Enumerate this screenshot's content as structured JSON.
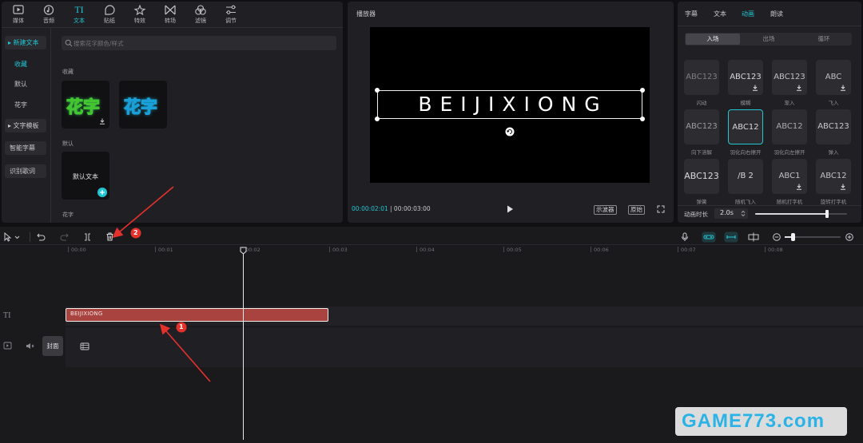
{
  "toolbar": {
    "tabs": [
      {
        "label": "媒体",
        "icon": "media-icon"
      },
      {
        "label": "音频",
        "icon": "audio-icon"
      },
      {
        "label": "文本",
        "icon": "text-icon",
        "active": true
      },
      {
        "label": "贴纸",
        "icon": "sticker-icon"
      },
      {
        "label": "特效",
        "icon": "effects-icon"
      },
      {
        "label": "转场",
        "icon": "transition-icon"
      },
      {
        "label": "滤镜",
        "icon": "filter-icon"
      },
      {
        "label": "调节",
        "icon": "adjust-icon"
      }
    ]
  },
  "sidebar": {
    "items": [
      {
        "label": "▸ 新建文本"
      },
      {
        "label": "收藏"
      },
      {
        "label": "默认"
      },
      {
        "label": "花字"
      },
      {
        "label": "▸ 文字模板"
      },
      {
        "label": "智能字幕"
      },
      {
        "label": "识别歌词"
      }
    ]
  },
  "library": {
    "search_placeholder": "搜索花字颜色/样式",
    "section_favorites": "收藏",
    "thumb1_text": "花字",
    "thumb2_text": "花字",
    "section_default": "默认",
    "default_text": "默认文本",
    "section_huazi": "花字"
  },
  "player": {
    "title": "播放器",
    "preview_text": "BEIJIXIONG",
    "current_time": "00:00:02:01",
    "total_time": "00:00:03:00",
    "btn_waveform": "示波器",
    "btn_original": "原始"
  },
  "inspector": {
    "tabs": [
      "字幕",
      "文本",
      "动画",
      "朗读"
    ],
    "active_tab": "动画",
    "subtabs": [
      "入场",
      "出场",
      "循环"
    ],
    "cells": [
      {
        "text": "ABC123",
        "label": "闪动"
      },
      {
        "text": "ABC123",
        "label": "模糊"
      },
      {
        "text": "ABC123",
        "label": "渐入"
      },
      {
        "text": "ABC",
        "label": "飞入"
      },
      {
        "text": "ABC123",
        "label": "向下溶解"
      },
      {
        "text": "ABC12",
        "label": "羽化向右擦开"
      },
      {
        "text": "ABC12",
        "label": "羽化向左擦开"
      },
      {
        "text": "ABC123",
        "label": "弹入"
      },
      {
        "text": "ABC123",
        "label": "弹簧"
      },
      {
        "text": "/B 2",
        "label": "随机飞入"
      },
      {
        "text": "ABC1",
        "label": "随机打字机"
      },
      {
        "text": "ABC12",
        "label": "旋转打字机"
      }
    ],
    "duration_label": "动画时长",
    "duration_value": "2.0s",
    "duration_fraction": 0.78
  },
  "timeline": {
    "ticks": [
      "00:00",
      "00:01",
      "00:02",
      "00:03",
      "00:04",
      "00:05",
      "00:06",
      "00:07",
      "00:08"
    ],
    "clip_text": "BEIJIXIONG",
    "cover_label": "封面",
    "track_text_icon": "TI"
  },
  "annotations": {
    "marker1": "1",
    "marker2": "2",
    "arrow_color": "#e5312c"
  },
  "watermark": {
    "text": "GAME773.com"
  }
}
